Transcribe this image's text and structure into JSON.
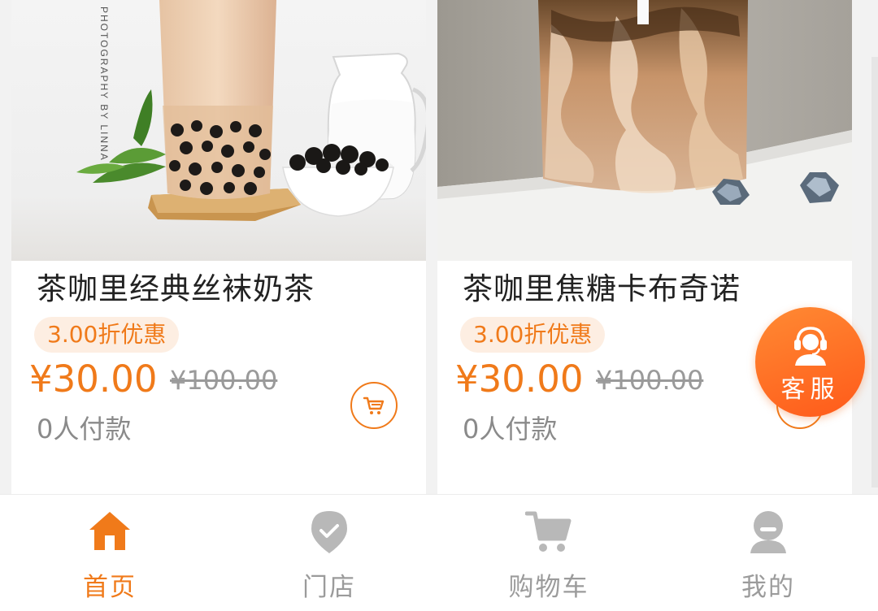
{
  "products": [
    {
      "name": "茶咖里经典丝袜奶茶",
      "discount": "3.00折优惠",
      "price": "¥30.00",
      "original_price": "¥100.00",
      "sold": "0人付款",
      "photo_caption": "PHOTOGRAPHY BY LINNA"
    },
    {
      "name": "茶咖里焦糖卡布奇诺",
      "discount": "3.00折优惠",
      "price": "¥30.00",
      "original_price": "¥100.00",
      "sold": "0人付款"
    }
  ],
  "service": {
    "label": "客服"
  },
  "tabbar": {
    "items": [
      {
        "label": "首页",
        "icon": "home-icon"
      },
      {
        "label": "门店",
        "icon": "store-icon"
      },
      {
        "label": "购物车",
        "icon": "cart-icon"
      },
      {
        "label": "我的",
        "icon": "user-icon"
      }
    ],
    "active_index": 0
  },
  "colors": {
    "accent": "#f07a1a",
    "badge_bg": "#fdeee2",
    "inactive": "#9b9b9b"
  }
}
